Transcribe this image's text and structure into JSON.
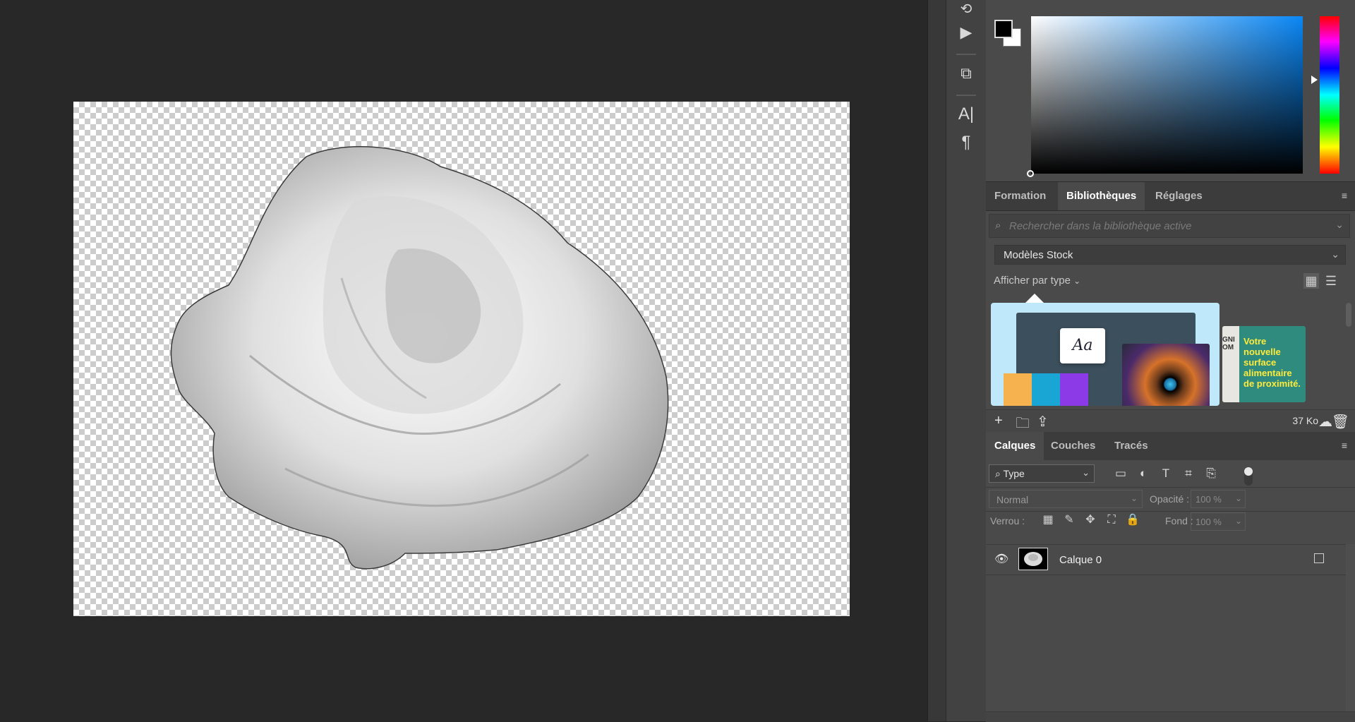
{
  "canvas": {
    "layer_name_visible": "Calque 0"
  },
  "toolstrip": {
    "icons": [
      "history-icon",
      "play-action-icon",
      "3d-icon",
      "character-icon",
      "paragraph-icon"
    ]
  },
  "color_picker": {
    "foreground": "#000000",
    "background": "#ffffff",
    "hue_color": "#0a87f5"
  },
  "library_panel": {
    "tabs": [
      {
        "label": "Formation"
      },
      {
        "label": "Bibliothèques"
      },
      {
        "label": "Réglages"
      }
    ],
    "active_tab": "Bibliothèques",
    "search_placeholder": "Rechercher dans la bibliothèque active",
    "library_select": "Modèles Stock",
    "filter_label": "Afficher par type",
    "promo_card_text": "Aa",
    "second_card_text": "Votre nouvelle surface alimentaire de proximité.",
    "second_card_side": "GNI\nOM",
    "footer_size": "37 Ko"
  },
  "layers_panel": {
    "tabs": [
      {
        "label": "Calques"
      },
      {
        "label": "Couches"
      },
      {
        "label": "Tracés"
      }
    ],
    "active_tab": "Calques",
    "filter_select": "Type",
    "blend_mode": "Normal",
    "opacity_label": "Opacité :",
    "opacity_value": "100 %",
    "lock_label": "Verrou :",
    "fill_label": "Fond :",
    "fill_value": "100 %",
    "layers": [
      {
        "name": "Calque 0",
        "visible": true
      }
    ]
  }
}
